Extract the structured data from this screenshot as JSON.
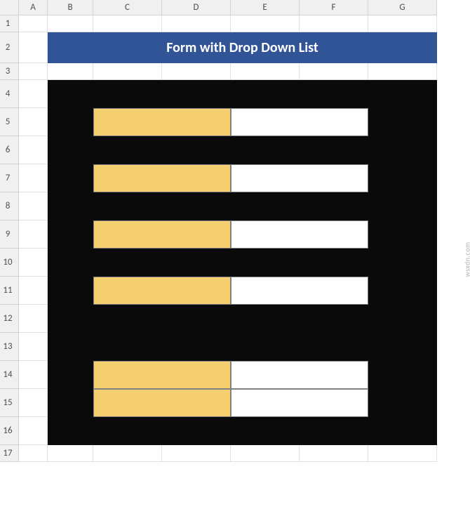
{
  "columns": [
    "A",
    "B",
    "C",
    "D",
    "E",
    "F",
    "G"
  ],
  "rows": [
    "1",
    "2",
    "3",
    "4",
    "5",
    "6",
    "7",
    "8",
    "9",
    "10",
    "11",
    "12",
    "13",
    "14",
    "15",
    "16",
    "17"
  ],
  "title": "Form with Drop Down List",
  "watermark": "wsxdn.com",
  "form": {
    "fields": [
      {
        "label": "",
        "value": ""
      },
      {
        "label": "",
        "value": ""
      },
      {
        "label": "",
        "value": ""
      },
      {
        "label": "",
        "value": ""
      },
      {
        "label": "",
        "value": ""
      },
      {
        "label": "",
        "value": ""
      }
    ]
  }
}
